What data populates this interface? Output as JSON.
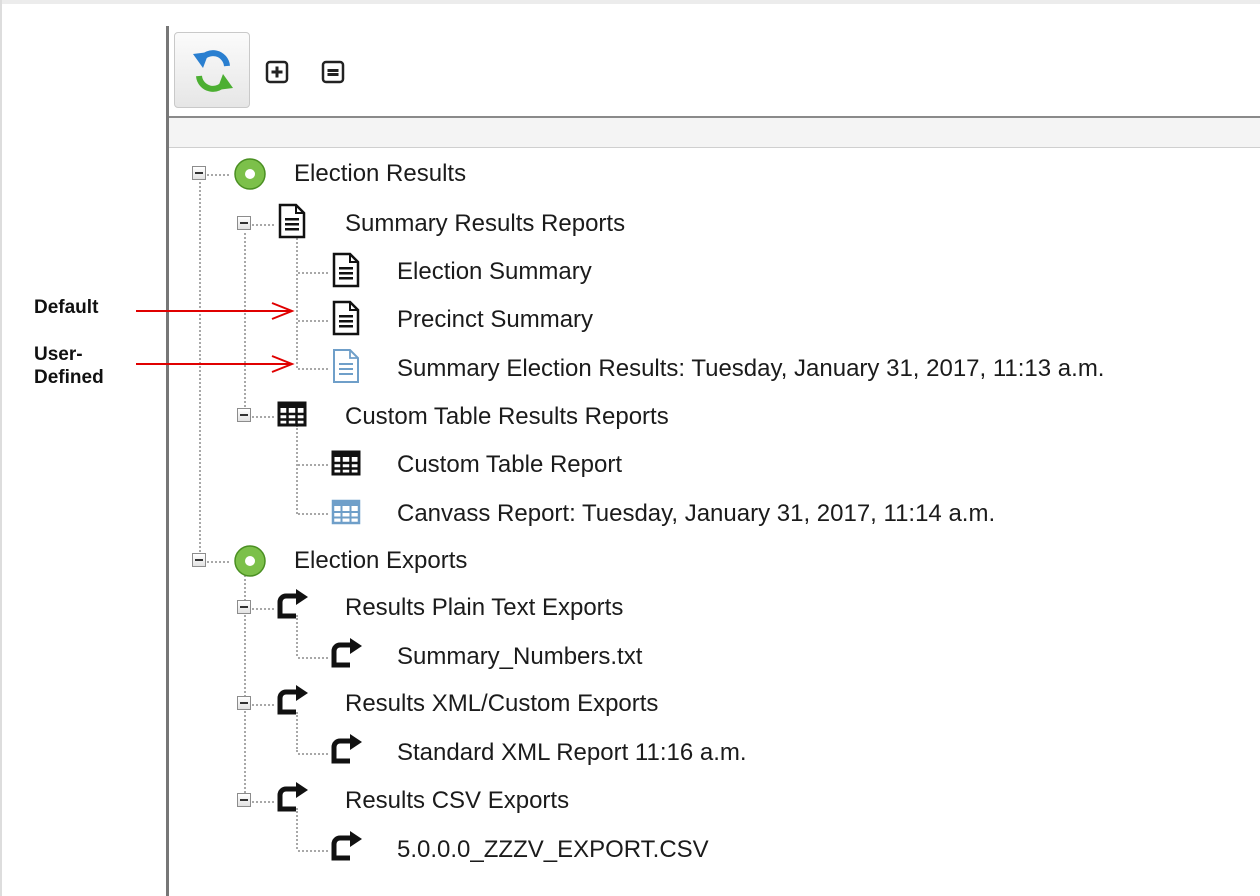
{
  "colors": {
    "tree_line": "#a8a8a8",
    "default_icon": "#111111",
    "user_defined_icon": "#6f9fc9",
    "arrow": "#e00000"
  },
  "toolbar": {
    "refresh_icon": "refresh-arrows-icon",
    "expand_icon": "expand-all-icon",
    "collapse_icon": "collapse-all-icon"
  },
  "annotations": {
    "default_label": "Default",
    "user_defined_label_line1": "User-",
    "user_defined_label_line2": "Defined"
  },
  "tree": {
    "election_results": {
      "label": "Election Results",
      "icon": "green-circle-icon",
      "summary_reports": {
        "label": "Summary Results Reports",
        "icon": "document-icon",
        "items": [
          {
            "label": "Election Summary",
            "icon": "document-icon",
            "type": "default"
          },
          {
            "label": "Precinct Summary",
            "icon": "document-icon",
            "type": "default"
          },
          {
            "label": "Summary Election Results: Tuesday, January 31, 2017, 11:13 a.m.",
            "icon": "document-icon",
            "type": "user-defined"
          }
        ]
      },
      "table_reports": {
        "label": "Custom Table Results Reports",
        "icon": "table-icon",
        "items": [
          {
            "label": "Custom Table Report",
            "icon": "table-icon",
            "type": "default"
          },
          {
            "label": "Canvass Report: Tuesday, January 31, 2017, 11:14 a.m.",
            "icon": "table-icon",
            "type": "user-defined"
          }
        ]
      }
    },
    "election_exports": {
      "label": "Election Exports",
      "icon": "green-circle-icon",
      "plain_text": {
        "label": "Results Plain Text Exports",
        "icon": "export-arrow-icon",
        "items": [
          {
            "label": "Summary_Numbers.txt",
            "icon": "export-arrow-icon"
          }
        ]
      },
      "xml": {
        "label": "Results XML/Custom Exports",
        "icon": "export-arrow-icon",
        "items": [
          {
            "label": "Standard XML Report 11:16 a.m.",
            "icon": "export-arrow-icon"
          }
        ]
      },
      "csv": {
        "label": "Results CSV Exports",
        "icon": "export-arrow-icon",
        "items": [
          {
            "label": "5.0.0.0_ZZZV_EXPORT.CSV",
            "icon": "export-arrow-icon"
          }
        ]
      }
    }
  }
}
